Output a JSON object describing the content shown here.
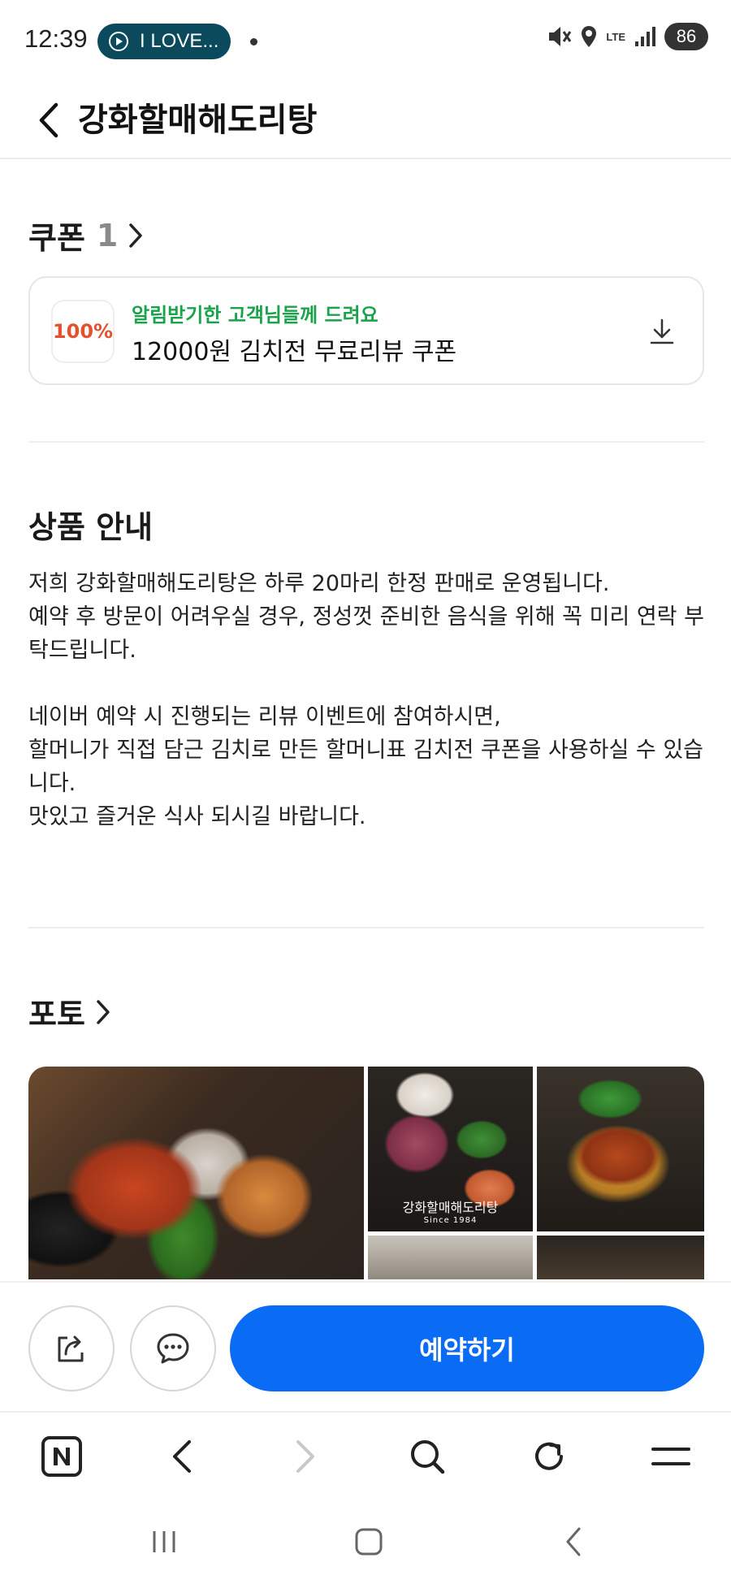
{
  "status_bar": {
    "time": "12:39",
    "media_label": "I LOVE...",
    "network": "LTE",
    "battery": "86"
  },
  "header": {
    "title": "강화할매해도리탕"
  },
  "coupon_section": {
    "title": "쿠폰",
    "count": "1",
    "coupon": {
      "badge": "100%",
      "subtitle": "알림받기한 고객님들께 드려요",
      "name": "12000원 김치전 무료리뷰 쿠폰"
    }
  },
  "info_section": {
    "title": "상품 안내",
    "lines": [
      "저희 강화할매해도리탕은 하루 20마리 한정 판매로 운영됩니다.",
      "예약 후 방문이 어려우실 경우, 정성껏 준비한 음식을 위해 꼭 미리 연락 부탁드립니다.",
      "네이버 예약 시 진행되는 리뷰 이벤트에 참여하시면,",
      "할머니가 직접 담근 김치로 만든 할머니표 김치전 쿠폰을 사용하실 수 있습니다.",
      "맛있고 즐거운 식사 되시길 바랍니다."
    ]
  },
  "photo_section": {
    "title": "포토",
    "logo_text": "강화할매해도리탕",
    "logo_since": "Since 1984"
  },
  "action_bar": {
    "reserve_label": "예약하기"
  },
  "colors": {
    "accent": "#0a6cf5",
    "coupon_sub": "#1aa34a",
    "coupon_badge": "#e4512e",
    "media_pill": "#0b4a5c"
  },
  "icons": {
    "share": "share-icon",
    "chat": "chat-icon",
    "download": "download-icon",
    "naver": "naver-n-icon",
    "search": "search-icon",
    "refresh": "refresh-icon",
    "menu": "menu-icon"
  }
}
